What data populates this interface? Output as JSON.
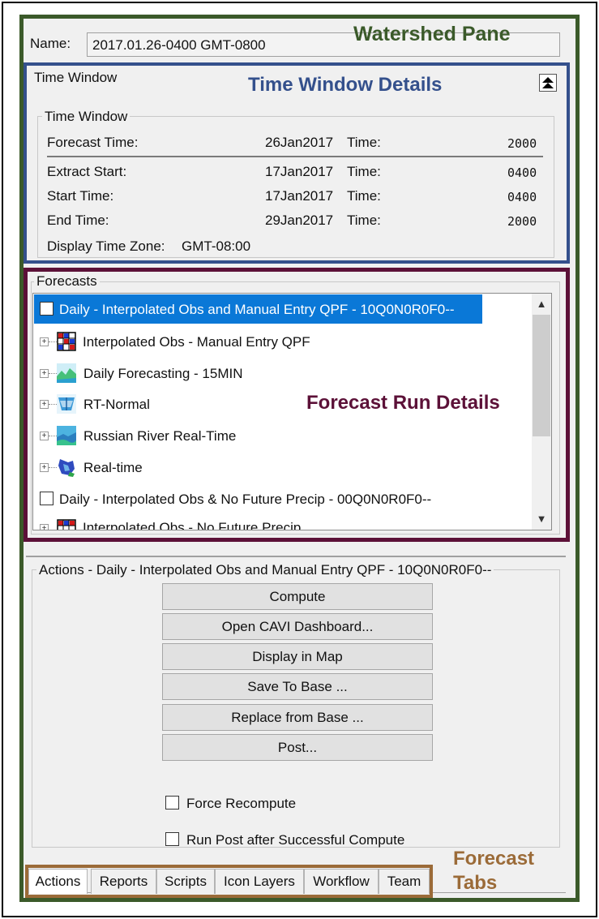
{
  "annotations": {
    "watershed_pane": "Watershed Pane",
    "time_window_details": "Time Window Details",
    "forecast_run_details": "Forecast Run Details",
    "forecast_tabs_line1": "Forecast",
    "forecast_tabs_line2": "Tabs"
  },
  "colors": {
    "watershed_border": "#3b5a2a",
    "time_window_border": "#34508c",
    "forecast_border": "#5c1138",
    "tabs_border": "#9b6b38",
    "selection": "#0a78d7"
  },
  "header": {
    "name_label": "Name:",
    "name_value": "2017.01.26-0400 GMT-0800"
  },
  "time_window": {
    "title": "Time Window",
    "group_label": "Time Window",
    "rows": [
      {
        "label": "Forecast Time:",
        "date": "26Jan2017",
        "time_label": "Time:",
        "time": "2000"
      },
      {
        "label": "Extract Start:",
        "date": "17Jan2017",
        "time_label": "Time:",
        "time": "0400"
      },
      {
        "label": "Start Time:",
        "date": "17Jan2017",
        "time_label": "Time:",
        "time": "0400"
      },
      {
        "label": "End Time:",
        "date": "29Jan2017",
        "time_label": "Time:",
        "time": "2000"
      }
    ],
    "zone_label": "Display Time Zone:",
    "zone_value": "GMT-08:00"
  },
  "forecasts": {
    "label": "Forecasts",
    "items": [
      {
        "label": "Daily - Interpolated Obs and Manual Entry QPF - 10Q0N0R0F0--",
        "kind": "run",
        "selected": true
      },
      {
        "label": "Interpolated Obs - Manual Entry QPF",
        "kind": "child",
        "icon": "grid-icon"
      },
      {
        "label": "Daily Forecasting - 15MIN",
        "kind": "child",
        "icon": "landscape-icon"
      },
      {
        "label": "RT-Normal",
        "kind": "child",
        "icon": "basin-icon"
      },
      {
        "label": "Russian River Real-Time",
        "kind": "child",
        "icon": "river-icon"
      },
      {
        "label": "Real-time",
        "kind": "child",
        "icon": "map-icon"
      },
      {
        "label": "Daily - Interpolated Obs & No Future Precip - 00Q0N0R0F0--",
        "kind": "run",
        "selected": false
      },
      {
        "label": "Interpolated Obs - No Future Precip",
        "kind": "child",
        "icon": "grid-icon"
      }
    ]
  },
  "actions": {
    "group_label": "Actions - Daily - Interpolated Obs and Manual Entry QPF - 10Q0N0R0F0--",
    "buttons": [
      "Compute",
      "Open CAVI Dashboard...",
      "Display in Map",
      "Save To Base ...",
      "Replace from Base ...",
      "Post..."
    ],
    "force_recompute": "Force Recompute",
    "run_post": "Run Post after Successful Compute"
  },
  "tabs": [
    "Actions",
    "Reports",
    "Scripts",
    "Icon Layers",
    "Workflow",
    "Team"
  ]
}
